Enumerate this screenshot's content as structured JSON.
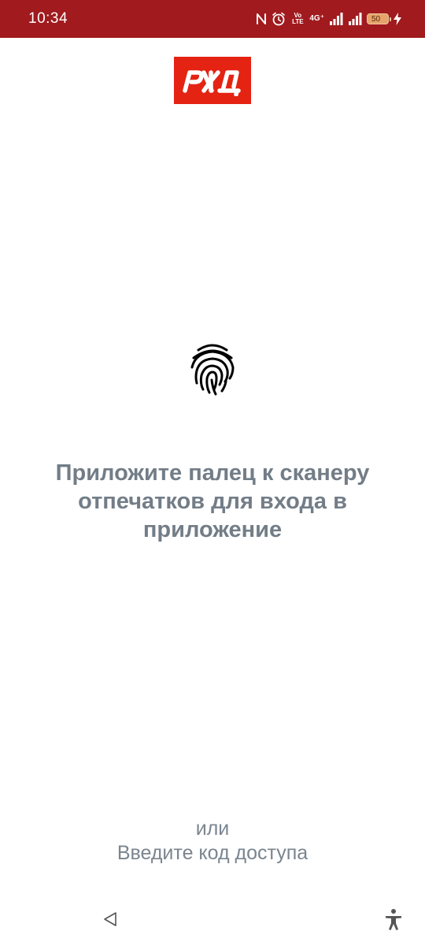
{
  "status_bar": {
    "time": "10:34",
    "volte_line1": "Vo",
    "volte_line2": "LTE",
    "network": "4G⁺",
    "battery": "50",
    "color": "#a01a1e"
  },
  "logo": {
    "icon": "rzd-logo",
    "color": "#e42313"
  },
  "main": {
    "icon": "fingerprint-icon",
    "prompt": "Приложите палец к сканеру отпечатков для входа в приложение",
    "or_label": "или",
    "code_link": "Введите код доступа",
    "text_color": "#727d87"
  },
  "nav_bar": {
    "back_icon": "back-triangle-icon",
    "accessibility_icon": "accessibility-icon"
  }
}
